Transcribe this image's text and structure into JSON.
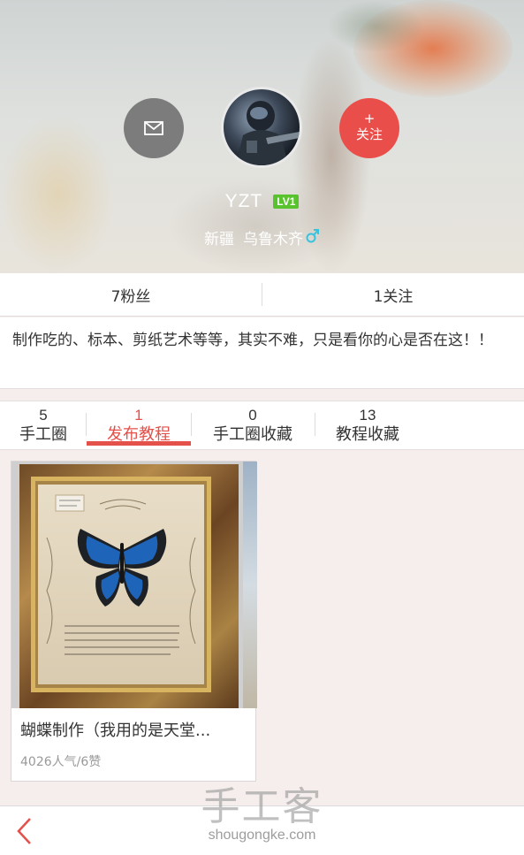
{
  "profile": {
    "username": "YZT",
    "level": "LV1",
    "province": "新疆",
    "city": "乌鲁木齐",
    "gender_icon": "male-icon",
    "follow_plus": "+",
    "follow_label": "关注"
  },
  "stats": {
    "fans": "7粉丝",
    "following": "1关注"
  },
  "bio": "制作吃的、标本、剪纸艺术等等，其实不难，只是看你的心是否在这！！",
  "tabs": [
    {
      "count": "5",
      "label": "手工圈"
    },
    {
      "count": "1",
      "label": "发布教程"
    },
    {
      "count": "0",
      "label": "手工圈收藏"
    },
    {
      "count": "13",
      "label": "教程收藏"
    }
  ],
  "active_tab": 1,
  "posts": [
    {
      "title": "蝴蝶制作（我用的是天堂...",
      "meta": "4026人气/6赞"
    }
  ],
  "watermark": {
    "main": "手工客",
    "sub": "shougongke.com"
  },
  "colors": {
    "accent": "#e4504a",
    "follow": "#ea4e4a",
    "level_badge": "#58c32c",
    "message_button": "#7c7c7c",
    "gender": "#35c4e0"
  }
}
